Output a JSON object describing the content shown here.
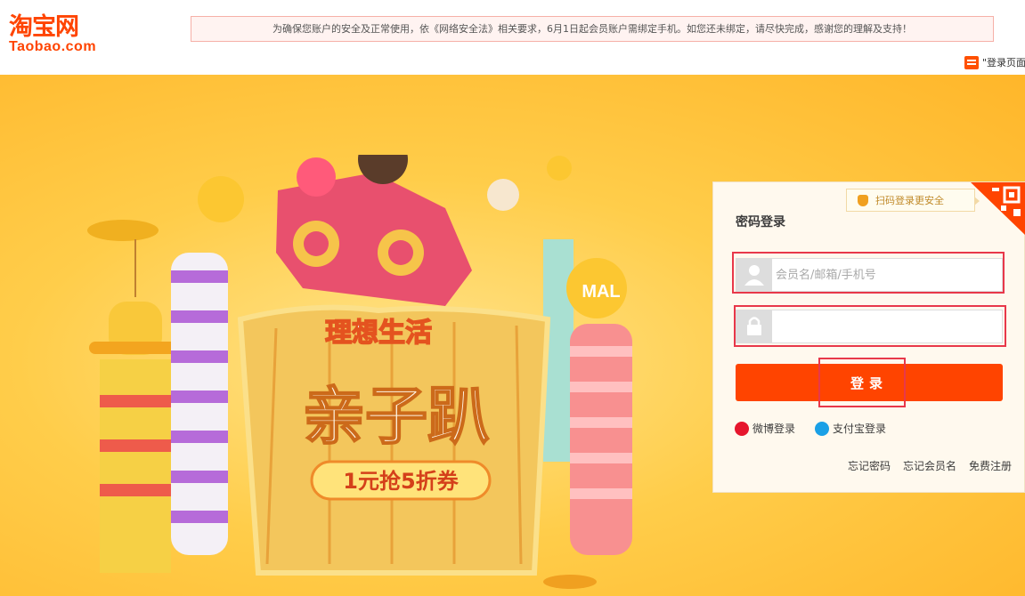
{
  "header": {
    "logo_cn": "淘宝网",
    "logo_en": "Taobao.com",
    "notice": "为确保您账户的安全及正常使用，依《网络安全法》相关要求，6月1日起会员账户需绑定手机。如您还未绑定，请尽快完成，感谢您的理解及支持！",
    "feedback_label": "\"登录页面"
  },
  "banner": {
    "slogan": "理想生活",
    "headline": "亲子趴",
    "coupon": "1元抢5折券",
    "tmall_sign": "MAL"
  },
  "login": {
    "qr_tip": "扫码登录更安全",
    "title": "密码登录",
    "username_placeholder": "会员名/邮箱/手机号",
    "password_value": "",
    "submit_label": "登录",
    "alt_weibo": "微博登录",
    "alt_alipay": "支付宝登录",
    "links": [
      "忘记密码",
      "忘记会员名",
      "免费注册"
    ]
  },
  "colors": {
    "brand": "#ff4400",
    "banner_bg": "#ffc43d",
    "highlight": "#e8384a"
  }
}
